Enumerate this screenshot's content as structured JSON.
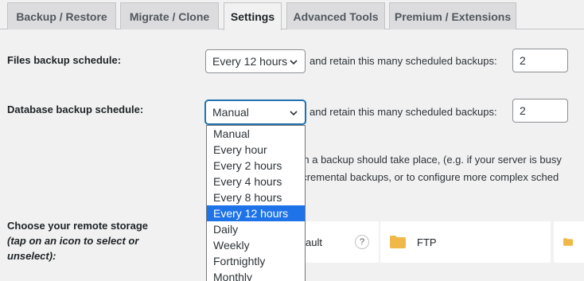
{
  "tabs": [
    {
      "label": "Backup / Restore",
      "active": false
    },
    {
      "label": "Migrate / Clone",
      "active": false
    },
    {
      "label": "Settings",
      "active": true
    },
    {
      "label": "Advanced Tools",
      "active": false
    },
    {
      "label": "Premium / Extensions",
      "active": false
    }
  ],
  "files_schedule": {
    "label": "Files backup schedule:",
    "selected": "Every 12 hours",
    "retain_label": "and retain this many scheduled backups:",
    "retain_value": "2"
  },
  "db_schedule": {
    "label": "Database backup schedule:",
    "selected": "Manual",
    "retain_label": "and retain this many scheduled backups:",
    "retain_value": "2"
  },
  "dropdown": {
    "options": [
      "Manual",
      "Every hour",
      "Every 2 hours",
      "Every 4 hours",
      "Every 8 hours",
      "Every 12 hours",
      "Daily",
      "Weekly",
      "Fortnightly",
      "Monthly"
    ],
    "highlighted": "Every 12 hours"
  },
  "help_text": {
    "line1": "ich a backup should take place, (e.g. if your server is busy",
    "line2": "ncremental backups, or to configure more complex sched"
  },
  "storage": {
    "label": "Choose your remote storage",
    "sublabel": "(tap on an icon to select or unselect):",
    "tiles": [
      {
        "name": "ault",
        "help": "?"
      },
      {
        "name": "FTP"
      }
    ]
  },
  "colors": {
    "accent": "#2271b1",
    "highlight": "#1e73e8",
    "folder": "#f0b849"
  }
}
